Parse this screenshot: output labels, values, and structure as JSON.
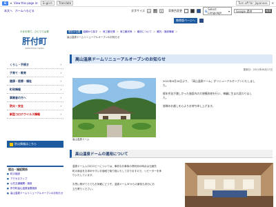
{
  "translate_bar": {
    "logo": "Google",
    "select_label": "English",
    "show_original": "Show original",
    "options_label": "Options ▾",
    "turn_off_label": "Turn off for: Japanese"
  },
  "header": {
    "top_links": [
      "本文へ",
      "ホームへもどる"
    ],
    "font_size_label": "文字サイズ",
    "font_small": "小",
    "font_large": "大",
    "font_std": "標",
    "bg_color_label": "背景色変更",
    "lang_select": "Select Language",
    "search_placeholder": "Google 提供",
    "search_button": "検索",
    "mobile_button": "携帯版ページへ",
    "sitemap_label": "□"
  },
  "logo": {
    "sub": "やまを育て、ひとりでは育",
    "main": "肝付町",
    "en": "KIMOTSUKI TOWN"
  },
  "side_menu": [
    {
      "label": "くらし・手続き",
      "red": false
    },
    {
      "label": "子育て・教育",
      "red": false
    },
    {
      "label": "健康・医療・福祉",
      "red": false
    },
    {
      "label": "町政情報",
      "red": false
    },
    {
      "label": "事業者の方へ",
      "red": false
    },
    {
      "label": "防災・安全",
      "red": true
    },
    {
      "label": "新型コロナウイルス情報",
      "red": true
    }
  ],
  "bosai_label": "防災情報はこちら",
  "facility": {
    "heading": "宿泊・施設関係",
    "items": [
      "町の施設",
      "アクセスマップ",
      "公共交通機関・施設",
      "肝付町高山温泉保養施設",
      "高山温泉ドームリニューアルオープンのお知らせ"
    ]
  },
  "breadcrumb": [
    "現在の位置",
    "組織から探す",
    "商工観光課",
    "商工観光係",
    "観光について",
    "観光・施設情報"
  ],
  "breadcrumb_current": "高山温泉ドームリニューアルオープンのお知らせ",
  "main": {
    "title": "高山温泉ドームリニューアルオープンのお知らせ",
    "updated": "更新日：2021年06月17日",
    "intro_lines": [
      "2020年6月26日より、「高山温泉ドーム」がリニューアルオープンいたしまし",
      "た。",
      "",
      "経年劣化が激しかった施設内の大規模改修を行い、綺麗に生まれ変わりまし",
      "た。",
      "",
      "皆様のお越しを心よりお待ち申し上げます。"
    ],
    "photo_caption": "高山温泉ドーム",
    "section_title": "高山温泉ドームの運用について",
    "body_lines": [
      "温泉ドーム入口のロビーについては、事前なお事後の長利用の時点は当面先",
      "町の商品をお求めやすいお値段で取り扱いたしておりますので、リピーターを承",
      "りいたしています。",
      "",
      "お買い物がてらでもお気軽にどうぞ。温泉ドーム3Fからの景色も存分にお",
      "立ち寄りください。"
    ]
  },
  "colors": {
    "accent": "#1e5aa0",
    "title_bg": "#dde9f7"
  }
}
